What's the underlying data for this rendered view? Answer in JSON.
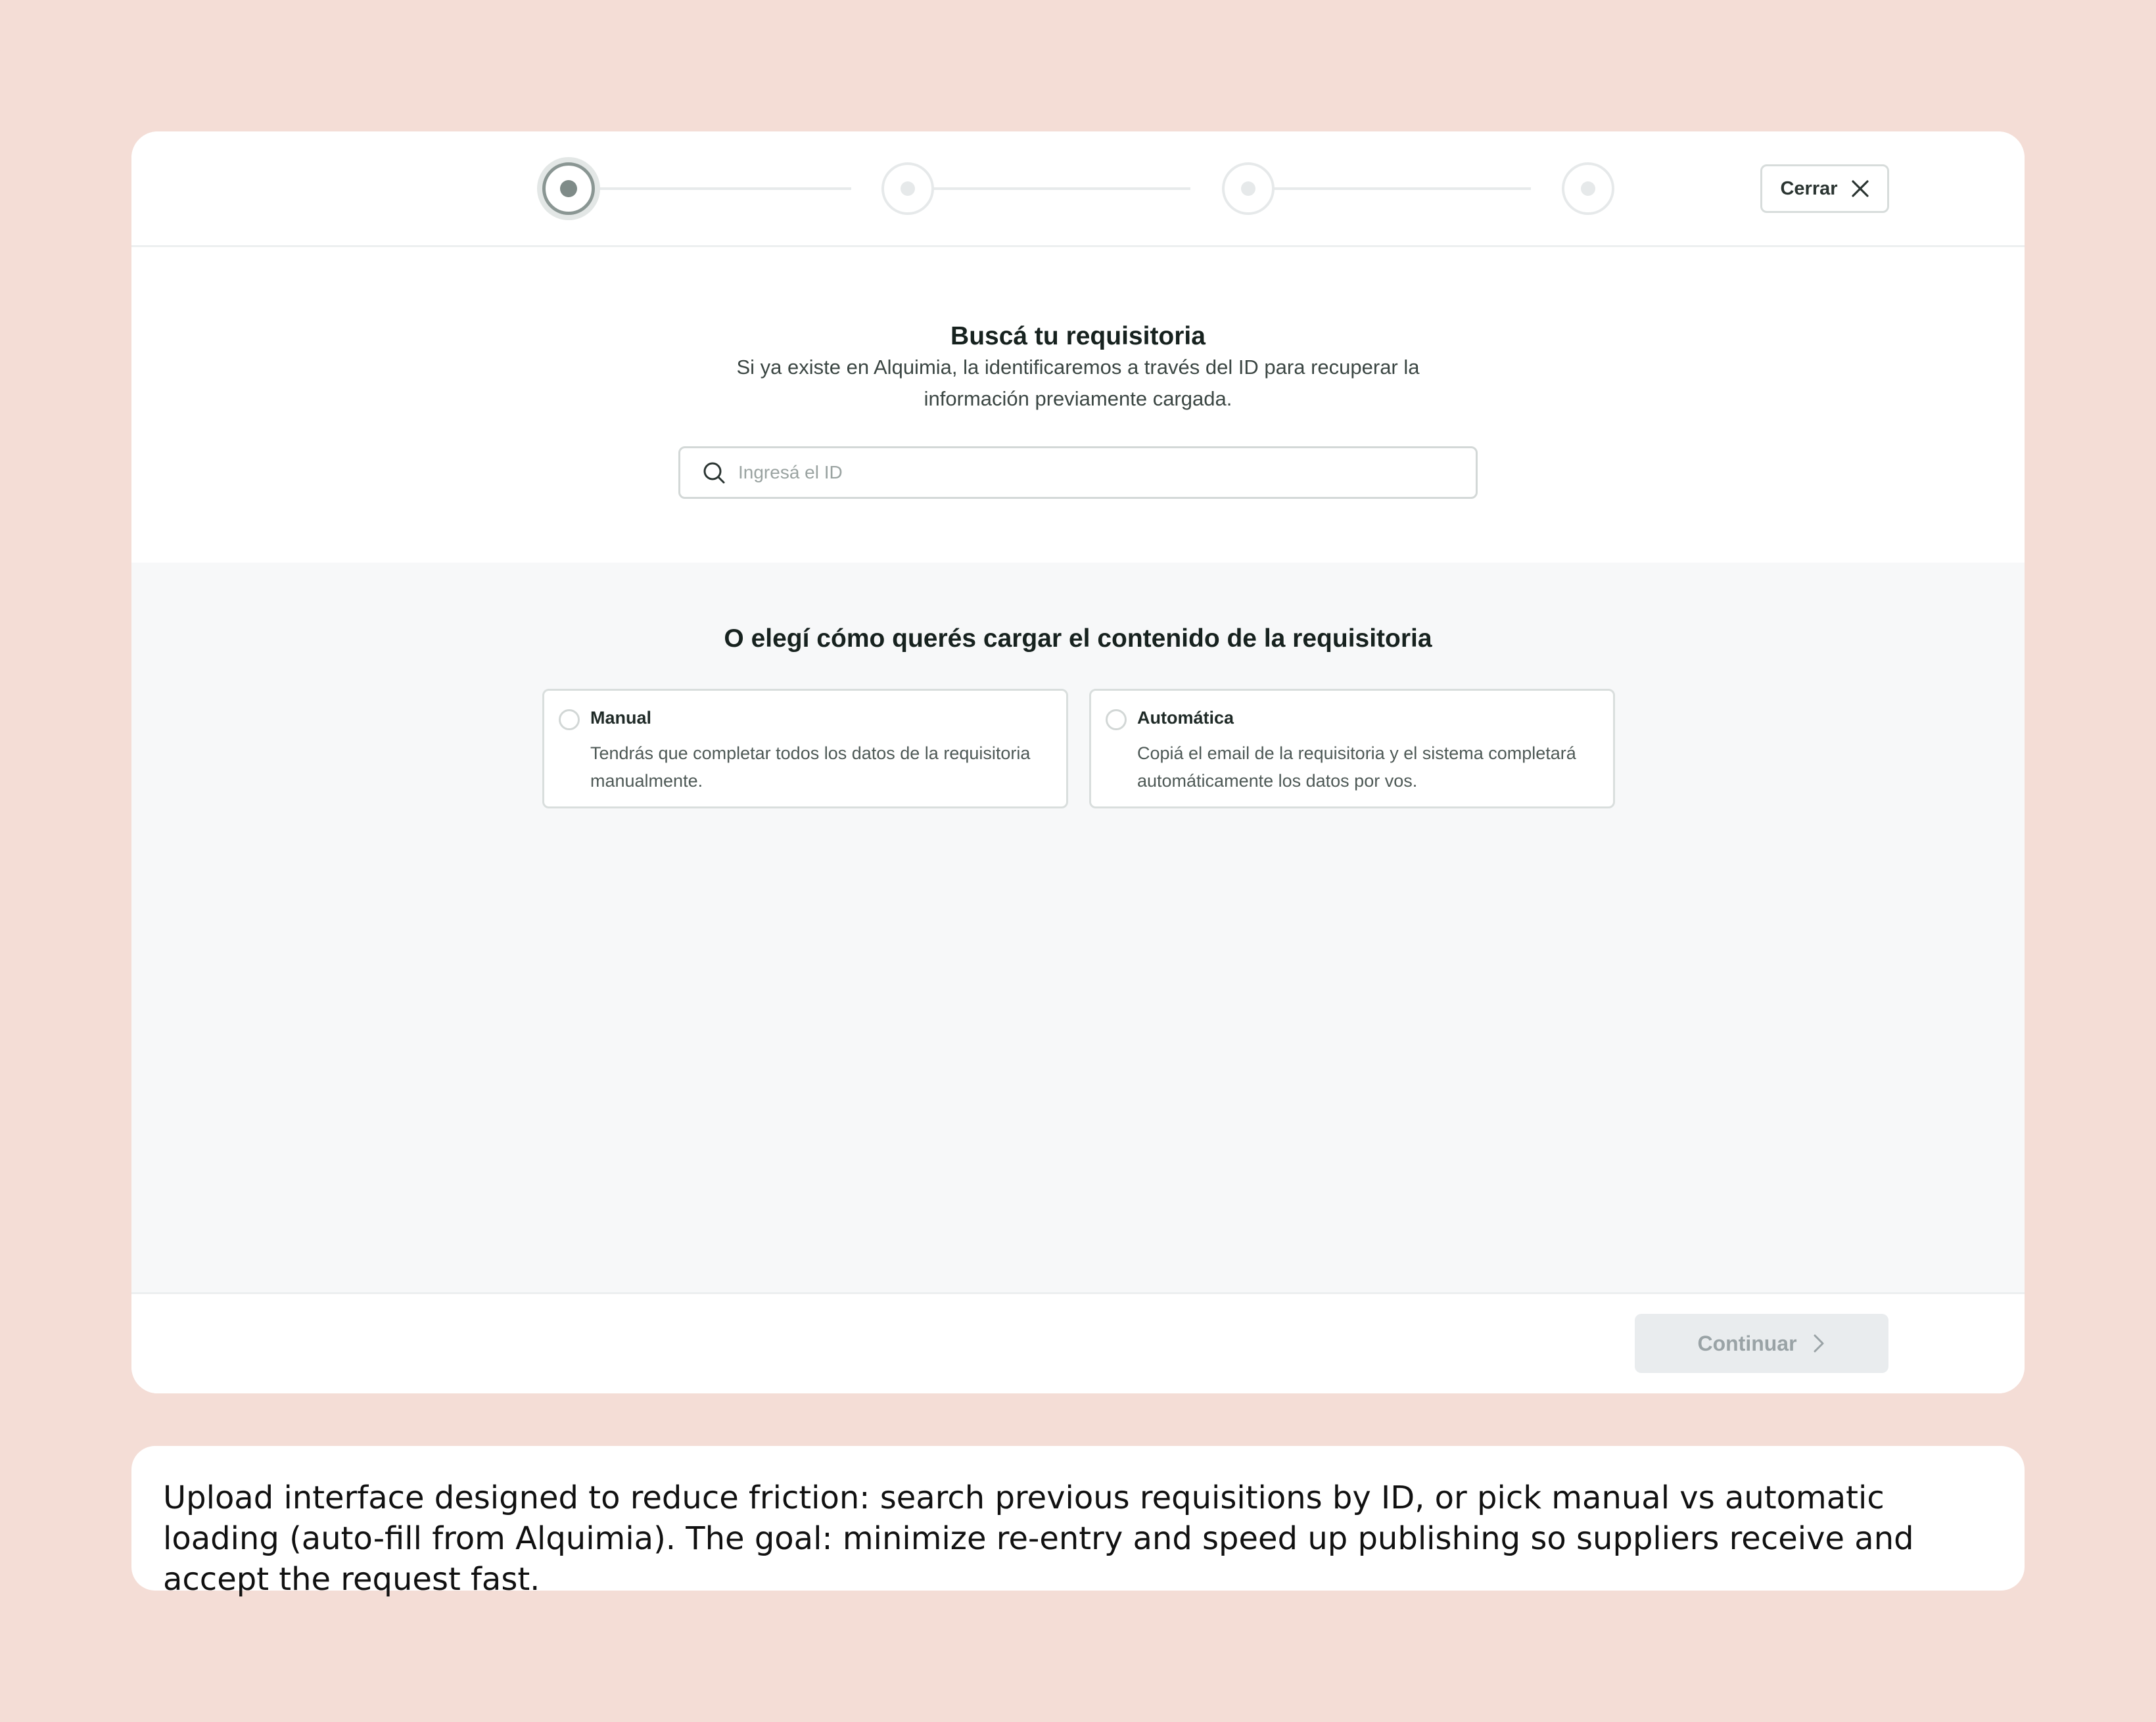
{
  "header": {
    "close_label": "Cerrar",
    "steps_total": 4,
    "current_step": 1
  },
  "search": {
    "title": "Buscá tu requisitoria",
    "subtitle": "Si ya existe en Alquimia, la identificaremos a través del ID para recuperar la información previamente cargada.",
    "placeholder": "Ingresá el ID",
    "value": ""
  },
  "options": {
    "title": "O elegí cómo querés cargar el contenido de la requisitoria",
    "items": [
      {
        "label": "Manual",
        "description": "Tendrás que completar todos los datos de la requisitoria manualmente.",
        "selected": false
      },
      {
        "label": "Automática",
        "description": "Copiá el email de la requisitoria y el sistema completará automáticamente los datos por vos.",
        "selected": false
      }
    ]
  },
  "footer": {
    "continue_label": "Continuar",
    "continue_enabled": false
  },
  "caption": {
    "text": "Upload interface designed to reduce friction: search previous requisitions by ID, or pick manual vs automatic loading (auto-fill from Alquimia). The goal: minimize re-entry and speed up publishing so suppliers receive and accept the request fast."
  },
  "colors": {
    "page_background": "#f4ddd6",
    "panel_background": "#f7f8f9",
    "active_step": "#7f8b88",
    "disabled_button": "#e9ecee"
  },
  "icons": [
    "close-icon",
    "search-icon",
    "chevron-right-icon"
  ]
}
